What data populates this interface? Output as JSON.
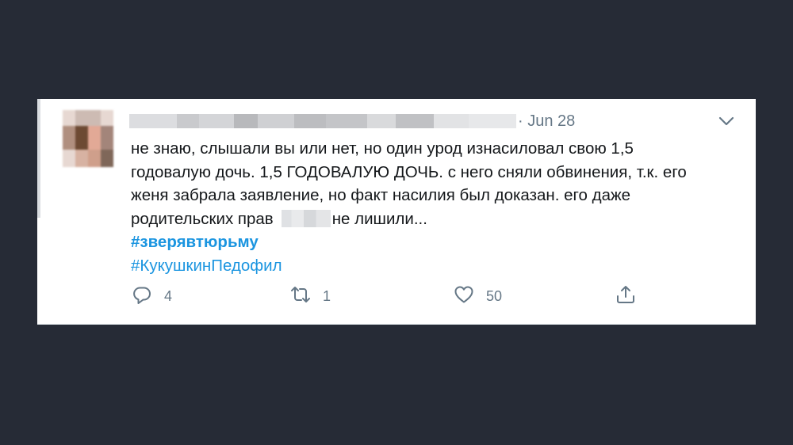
{
  "tweet": {
    "timestamp": "· Jun 28",
    "text_lines": [
      "не знаю, слышали вы или нет, но один урод изнасиловал свою 1,5",
      "годовалую дочь. 1,5 ГОДОВАЛУЮ ДОЧЬ. с него сняли обвинения, т.к. его",
      "женя забрала заявление, но факт насилия был доказан. его даже"
    ],
    "last_line_prefix": "родительских прав",
    "last_line_suffix": "не лишили...",
    "hashtags": [
      "#зверявтюрьму",
      "#КукушкинПедофил"
    ],
    "actions": {
      "reply_count": "4",
      "retweet_count": "1",
      "like_count": "50"
    }
  },
  "colors": {
    "background": "#262b36",
    "card": "#ffffff",
    "text": "#14171a",
    "muted": "#657786",
    "link": "#1b95e0"
  },
  "icons": [
    "chevron-down-icon",
    "reply-icon",
    "retweet-icon",
    "like-icon",
    "share-icon"
  ]
}
